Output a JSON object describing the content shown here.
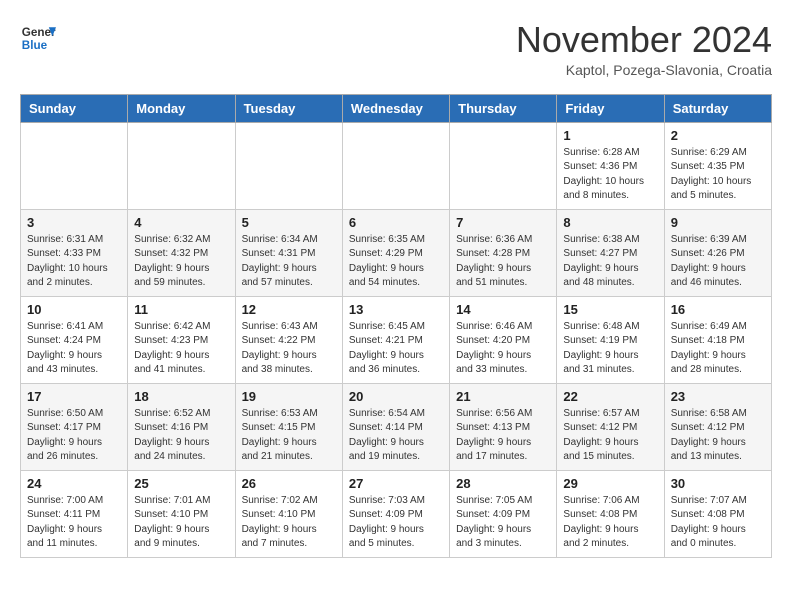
{
  "header": {
    "logo_general": "General",
    "logo_blue": "Blue",
    "month_title": "November 2024",
    "subtitle": "Kaptol, Pozega-Slavonia, Croatia"
  },
  "days_of_week": [
    "Sunday",
    "Monday",
    "Tuesday",
    "Wednesday",
    "Thursday",
    "Friday",
    "Saturday"
  ],
  "weeks": [
    [
      {
        "day": "",
        "info": ""
      },
      {
        "day": "",
        "info": ""
      },
      {
        "day": "",
        "info": ""
      },
      {
        "day": "",
        "info": ""
      },
      {
        "day": "",
        "info": ""
      },
      {
        "day": "1",
        "info": "Sunrise: 6:28 AM\nSunset: 4:36 PM\nDaylight: 10 hours and 8 minutes."
      },
      {
        "day": "2",
        "info": "Sunrise: 6:29 AM\nSunset: 4:35 PM\nDaylight: 10 hours and 5 minutes."
      }
    ],
    [
      {
        "day": "3",
        "info": "Sunrise: 6:31 AM\nSunset: 4:33 PM\nDaylight: 10 hours and 2 minutes."
      },
      {
        "day": "4",
        "info": "Sunrise: 6:32 AM\nSunset: 4:32 PM\nDaylight: 9 hours and 59 minutes."
      },
      {
        "day": "5",
        "info": "Sunrise: 6:34 AM\nSunset: 4:31 PM\nDaylight: 9 hours and 57 minutes."
      },
      {
        "day": "6",
        "info": "Sunrise: 6:35 AM\nSunset: 4:29 PM\nDaylight: 9 hours and 54 minutes."
      },
      {
        "day": "7",
        "info": "Sunrise: 6:36 AM\nSunset: 4:28 PM\nDaylight: 9 hours and 51 minutes."
      },
      {
        "day": "8",
        "info": "Sunrise: 6:38 AM\nSunset: 4:27 PM\nDaylight: 9 hours and 48 minutes."
      },
      {
        "day": "9",
        "info": "Sunrise: 6:39 AM\nSunset: 4:26 PM\nDaylight: 9 hours and 46 minutes."
      }
    ],
    [
      {
        "day": "10",
        "info": "Sunrise: 6:41 AM\nSunset: 4:24 PM\nDaylight: 9 hours and 43 minutes."
      },
      {
        "day": "11",
        "info": "Sunrise: 6:42 AM\nSunset: 4:23 PM\nDaylight: 9 hours and 41 minutes."
      },
      {
        "day": "12",
        "info": "Sunrise: 6:43 AM\nSunset: 4:22 PM\nDaylight: 9 hours and 38 minutes."
      },
      {
        "day": "13",
        "info": "Sunrise: 6:45 AM\nSunset: 4:21 PM\nDaylight: 9 hours and 36 minutes."
      },
      {
        "day": "14",
        "info": "Sunrise: 6:46 AM\nSunset: 4:20 PM\nDaylight: 9 hours and 33 minutes."
      },
      {
        "day": "15",
        "info": "Sunrise: 6:48 AM\nSunset: 4:19 PM\nDaylight: 9 hours and 31 minutes."
      },
      {
        "day": "16",
        "info": "Sunrise: 6:49 AM\nSunset: 4:18 PM\nDaylight: 9 hours and 28 minutes."
      }
    ],
    [
      {
        "day": "17",
        "info": "Sunrise: 6:50 AM\nSunset: 4:17 PM\nDaylight: 9 hours and 26 minutes."
      },
      {
        "day": "18",
        "info": "Sunrise: 6:52 AM\nSunset: 4:16 PM\nDaylight: 9 hours and 24 minutes."
      },
      {
        "day": "19",
        "info": "Sunrise: 6:53 AM\nSunset: 4:15 PM\nDaylight: 9 hours and 21 minutes."
      },
      {
        "day": "20",
        "info": "Sunrise: 6:54 AM\nSunset: 4:14 PM\nDaylight: 9 hours and 19 minutes."
      },
      {
        "day": "21",
        "info": "Sunrise: 6:56 AM\nSunset: 4:13 PM\nDaylight: 9 hours and 17 minutes."
      },
      {
        "day": "22",
        "info": "Sunrise: 6:57 AM\nSunset: 4:12 PM\nDaylight: 9 hours and 15 minutes."
      },
      {
        "day": "23",
        "info": "Sunrise: 6:58 AM\nSunset: 4:12 PM\nDaylight: 9 hours and 13 minutes."
      }
    ],
    [
      {
        "day": "24",
        "info": "Sunrise: 7:00 AM\nSunset: 4:11 PM\nDaylight: 9 hours and 11 minutes."
      },
      {
        "day": "25",
        "info": "Sunrise: 7:01 AM\nSunset: 4:10 PM\nDaylight: 9 hours and 9 minutes."
      },
      {
        "day": "26",
        "info": "Sunrise: 7:02 AM\nSunset: 4:10 PM\nDaylight: 9 hours and 7 minutes."
      },
      {
        "day": "27",
        "info": "Sunrise: 7:03 AM\nSunset: 4:09 PM\nDaylight: 9 hours and 5 minutes."
      },
      {
        "day": "28",
        "info": "Sunrise: 7:05 AM\nSunset: 4:09 PM\nDaylight: 9 hours and 3 minutes."
      },
      {
        "day": "29",
        "info": "Sunrise: 7:06 AM\nSunset: 4:08 PM\nDaylight: 9 hours and 2 minutes."
      },
      {
        "day": "30",
        "info": "Sunrise: 7:07 AM\nSunset: 4:08 PM\nDaylight: 9 hours and 0 minutes."
      }
    ]
  ]
}
